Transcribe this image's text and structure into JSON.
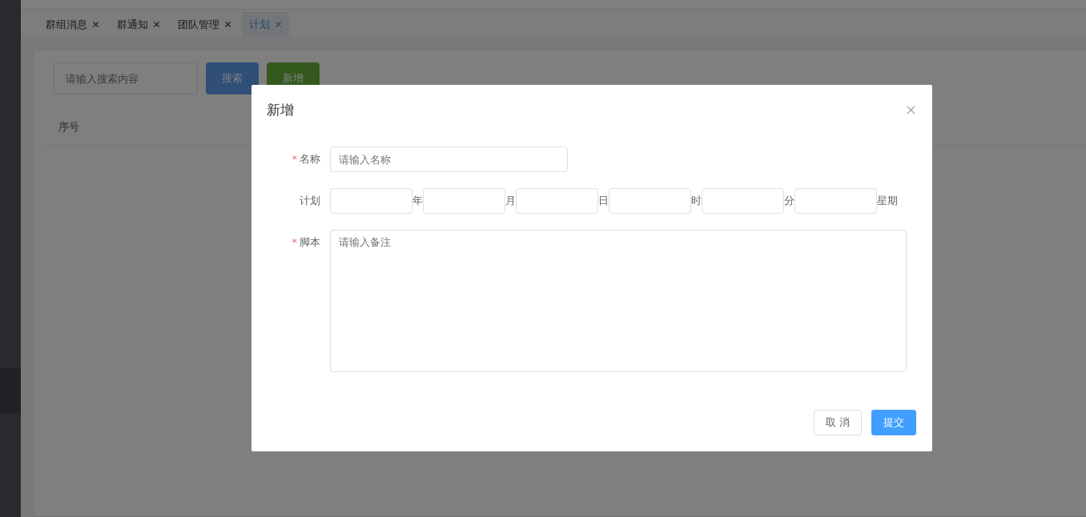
{
  "tabs": [
    {
      "label": "群组消息",
      "selected": false
    },
    {
      "label": "群通知",
      "selected": false
    },
    {
      "label": "团队管理",
      "selected": false
    },
    {
      "label": "计划",
      "selected": true
    }
  ],
  "search": {
    "placeholder": "请输入搜索内容"
  },
  "toolbar_buttons": [
    {
      "label": "搜索",
      "kind": "primary"
    },
    {
      "label": "新增",
      "kind": "success"
    }
  ],
  "table": {
    "columns": [
      "序号"
    ]
  },
  "dialog": {
    "title": "新增",
    "required_mark": "*",
    "name_field": {
      "label": "名称",
      "required": true,
      "placeholder": "请输入名称"
    },
    "plan_field": {
      "label": "计划",
      "required": false,
      "units": [
        "年",
        "月",
        "日",
        "时",
        "分",
        "星期"
      ]
    },
    "script_field": {
      "label": "脚本",
      "required": true,
      "placeholder": "请输入备注"
    },
    "buttons": [
      {
        "label": "取 消",
        "kind": "default"
      },
      {
        "label": "提交",
        "kind": "primary"
      }
    ]
  }
}
